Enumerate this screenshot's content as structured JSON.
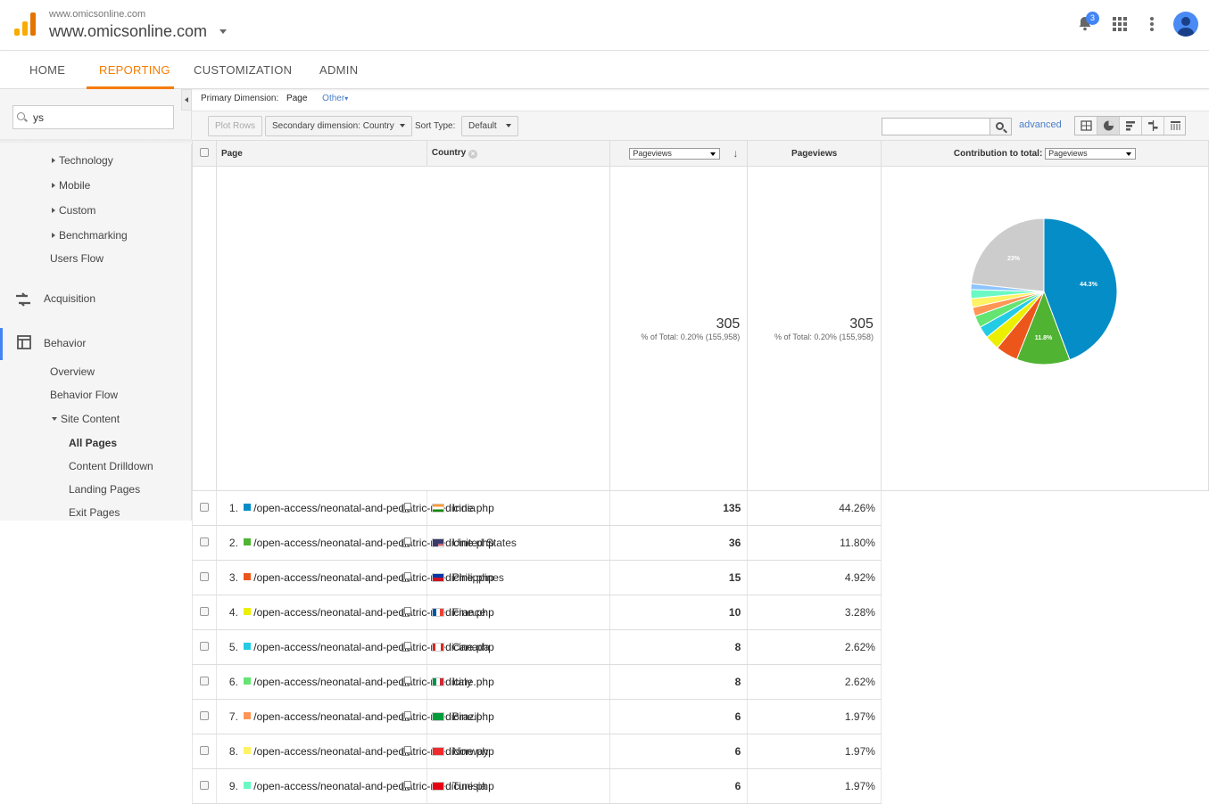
{
  "header": {
    "site_small": "www.omicsonline.com",
    "site_big": "www.omicsonline.com",
    "notification_count": "3"
  },
  "nav": {
    "tabs": [
      {
        "label": "HOME"
      },
      {
        "label": "REPORTING"
      },
      {
        "label": "CUSTOMIZATION"
      },
      {
        "label": "ADMIN"
      }
    ]
  },
  "sidebar": {
    "search_value": "ys",
    "items": {
      "technology": "Technology",
      "mobile": "Mobile",
      "custom": "Custom",
      "benchmarking": "Benchmarking",
      "users_flow": "Users Flow",
      "acquisition": "Acquisition",
      "behavior": "Behavior",
      "overview": "Overview",
      "behavior_flow": "Behavior Flow",
      "site_content": "Site Content",
      "all_pages": "All Pages",
      "content_drilldown": "Content Drilldown",
      "landing_pages": "Landing Pages",
      "exit_pages": "Exit Pages"
    }
  },
  "report": {
    "primary_dimension_label": "Primary Dimension:",
    "primary_dimension_value": "Page",
    "other_label": "Other",
    "plot_rows": "Plot Rows",
    "secondary_dimension": "Secondary dimension: Country",
    "sort_type_label": "Sort Type:",
    "sort_type_value": "Default",
    "advanced": "advanced",
    "columns": {
      "page": "Page",
      "country": "Country",
      "metric_select": "Pageviews",
      "pageviews": "Pageviews",
      "contribution_label": "Contribution to total:",
      "contribution_select": "Pageviews"
    },
    "totals": {
      "value1": "305",
      "pct1": "% of Total: 0.20% (155,958)",
      "value2": "305",
      "pct2": "% of Total: 0.20% (155,958)"
    },
    "rows": [
      {
        "idx": "1.",
        "page": "/open-access/neonatal-and-pediatric-medicine.php",
        "country": "India",
        "views": "135",
        "pct": "44.26%",
        "color": "#058dc7"
      },
      {
        "idx": "2.",
        "page": "/open-access/neonatal-and-pediatric-medicine.php",
        "country": "United States",
        "views": "36",
        "pct": "11.80%",
        "color": "#50b432"
      },
      {
        "idx": "3.",
        "page": "/open-access/neonatal-and-pediatric-medicine.php",
        "country": "Philippines",
        "views": "15",
        "pct": "4.92%",
        "color": "#ed561b"
      },
      {
        "idx": "4.",
        "page": "/open-access/neonatal-and-pediatric-medicine.php",
        "country": "France",
        "views": "10",
        "pct": "3.28%",
        "color": "#edef00"
      },
      {
        "idx": "5.",
        "page": "/open-access/neonatal-and-pediatric-medicine.php",
        "country": "Canada",
        "views": "8",
        "pct": "2.62%",
        "color": "#24cbe5"
      },
      {
        "idx": "6.",
        "page": "/open-access/neonatal-and-pediatric-medicine.php",
        "country": "Italy",
        "views": "8",
        "pct": "2.62%",
        "color": "#64e572"
      },
      {
        "idx": "7.",
        "page": "/open-access/neonatal-and-pediatric-medicine.php",
        "country": "Brazil",
        "views": "6",
        "pct": "1.97%",
        "color": "#ff9655"
      },
      {
        "idx": "8.",
        "page": "/open-access/neonatal-and-pediatric-medicine.php",
        "country": "Norway",
        "views": "6",
        "pct": "1.97%",
        "color": "#fff263"
      },
      {
        "idx": "9.",
        "page": "/open-access/neonatal-and-pediatric-medicine.php",
        "country": "Tunisia",
        "views": "6",
        "pct": "1.97%",
        "color": "#6af9c4"
      }
    ]
  },
  "chart_data": {
    "type": "pie",
    "slices": [
      {
        "label": "India",
        "value": 44.26,
        "color": "#058dc7",
        "text": "44.3%"
      },
      {
        "label": "United States",
        "value": 11.8,
        "color": "#50b432",
        "text": "11.8%"
      },
      {
        "label": "Philippines",
        "value": 4.92,
        "color": "#ed561b",
        "text": ""
      },
      {
        "label": "France",
        "value": 3.28,
        "color": "#edef00",
        "text": ""
      },
      {
        "label": "Canada",
        "value": 2.62,
        "color": "#24cbe5",
        "text": ""
      },
      {
        "label": "Italy",
        "value": 2.62,
        "color": "#64e572",
        "text": ""
      },
      {
        "label": "Brazil",
        "value": 1.97,
        "color": "#ff9655",
        "text": ""
      },
      {
        "label": "Norway",
        "value": 1.97,
        "color": "#fff263",
        "text": ""
      },
      {
        "label": "Tunisia",
        "value": 1.97,
        "color": "#6af9c4",
        "text": ""
      },
      {
        "label": "Other row",
        "value": 1.3,
        "color": "#8ec5ff",
        "text": ""
      },
      {
        "label": "Other",
        "value": 23.29,
        "color": "#cccccc",
        "text": "23%"
      }
    ]
  }
}
